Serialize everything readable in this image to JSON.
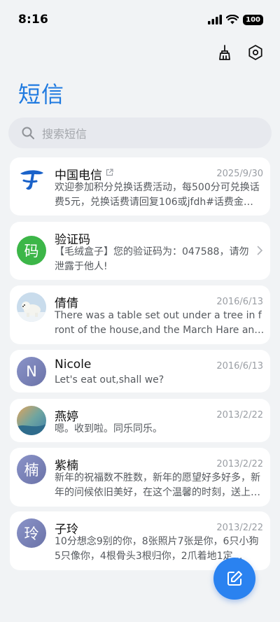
{
  "status": {
    "time": "8:16",
    "battery": "100"
  },
  "title": "短信",
  "search": {
    "placeholder": "搜索短信"
  },
  "icons": {
    "clean": "broom-icon",
    "settings": "settings-icon",
    "compose": "compose-icon"
  },
  "colors": {
    "accent": "#1f7ae0",
    "fab": "#2a82f0",
    "otp_avatar": "#3cb648"
  },
  "conversations": [
    {
      "name": "中国电信",
      "date": "2025/9/30",
      "preview": "欢迎参加积分兑换话费活动，每500分可兑换话费5元，兑换话费请回复106或jfdh#话费金…",
      "avatar_char": ""
    },
    {
      "name": "验证码",
      "date": "",
      "preview": "【毛绒盒子】您的验证码为：047588，请勿泄露于他人!",
      "avatar_char": "码"
    },
    {
      "name": "倩倩",
      "date": "2016/6/13",
      "preview": "There was a table set out under a tree in front of the house,and the March Hare and …",
      "avatar_char": ""
    },
    {
      "name": "Nicole",
      "date": "2016/6/13",
      "preview": "Let's eat out,shall we?",
      "avatar_char": "N"
    },
    {
      "name": "燕婷",
      "date": "2013/2/22",
      "preview": "嗯。收到啦。同乐同乐。",
      "avatar_char": ""
    },
    {
      "name": "紫楠",
      "date": "2013/2/22",
      "preview": "新年的祝福数不胜数，新年的愿望好多好多，新年的问候依旧美好，在这个温馨的时刻，送上…",
      "avatar_char": "楠"
    },
    {
      "name": "子玲",
      "date": "2013/2/22",
      "preview": "10分想念9别的你，8张照片7张是你，6只小狗5只像你，4根骨头3根归你，2爪着地1定…",
      "avatar_char": "玲"
    }
  ]
}
